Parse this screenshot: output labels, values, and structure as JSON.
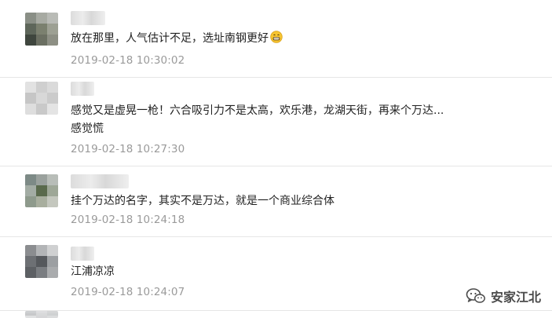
{
  "comments": [
    {
      "text": "放在那里，人气估计不足，选址南钢更好",
      "emoji": "grinning-face-icon",
      "time": "2019-02-18 10:30:02"
    },
    {
      "text": "感觉又是虚晃一枪！六合吸引力不是太高，欢乐港，龙湖天街，再来个万达...",
      "text_line2": "感觉慌",
      "time": "2019-02-18 10:27:30"
    },
    {
      "text": "挂个万达的名字，其实不是万达，就是一个商业综合体",
      "time": "2019-02-18 10:24:18"
    },
    {
      "text": "江浦凉凉",
      "time": "2019-02-18 10:24:07"
    }
  ],
  "watermark": {
    "text": "安家江北",
    "icon": "wechat-icon"
  }
}
